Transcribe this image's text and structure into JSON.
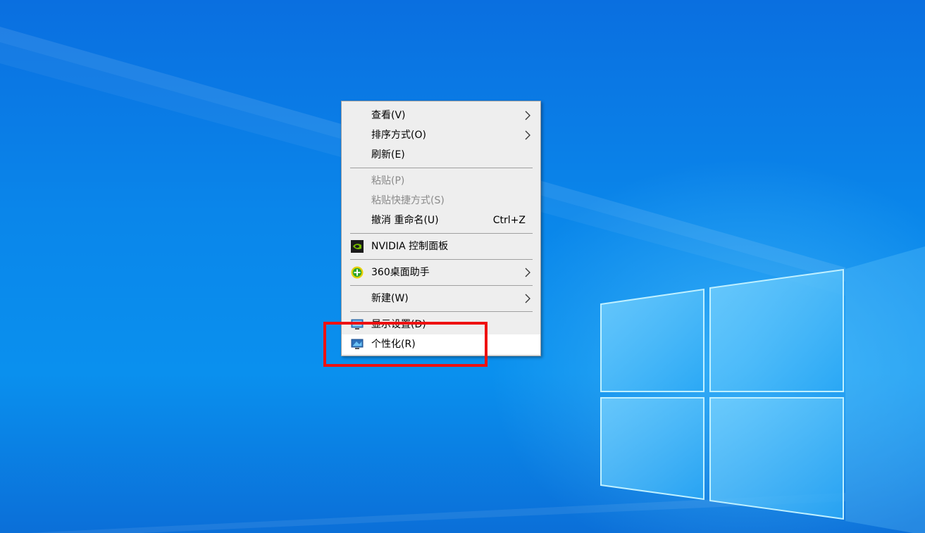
{
  "colors": {
    "desktop_blue": "#0a86ea",
    "menu_background": "#eeeeee",
    "menu_highlight": "#ffffff",
    "annotation_red": "#ee1111"
  },
  "context_menu": {
    "items": [
      {
        "label": "查看(V)",
        "submenu": true
      },
      {
        "label": "排序方式(O)",
        "submenu": true
      },
      {
        "label": "刷新(E)"
      },
      {
        "label": "粘贴(P)",
        "disabled": true
      },
      {
        "label": "粘贴快捷方式(S)",
        "disabled": true
      },
      {
        "label": "撤消 重命名(U)",
        "shortcut": "Ctrl+Z"
      },
      {
        "label": "NVIDIA 控制面板",
        "icon": "nvidia-icon"
      },
      {
        "label": "360桌面助手",
        "icon": "360-plus-icon",
        "submenu": true
      },
      {
        "label": "新建(W)",
        "submenu": true
      },
      {
        "label": "显示设置(D)",
        "icon": "display-icon"
      },
      {
        "label": "个性化(R)",
        "icon": "personalize-icon",
        "highlighted": true
      }
    ]
  },
  "annotation": {
    "type": "red-rectangle",
    "target": "个性化(R)"
  }
}
